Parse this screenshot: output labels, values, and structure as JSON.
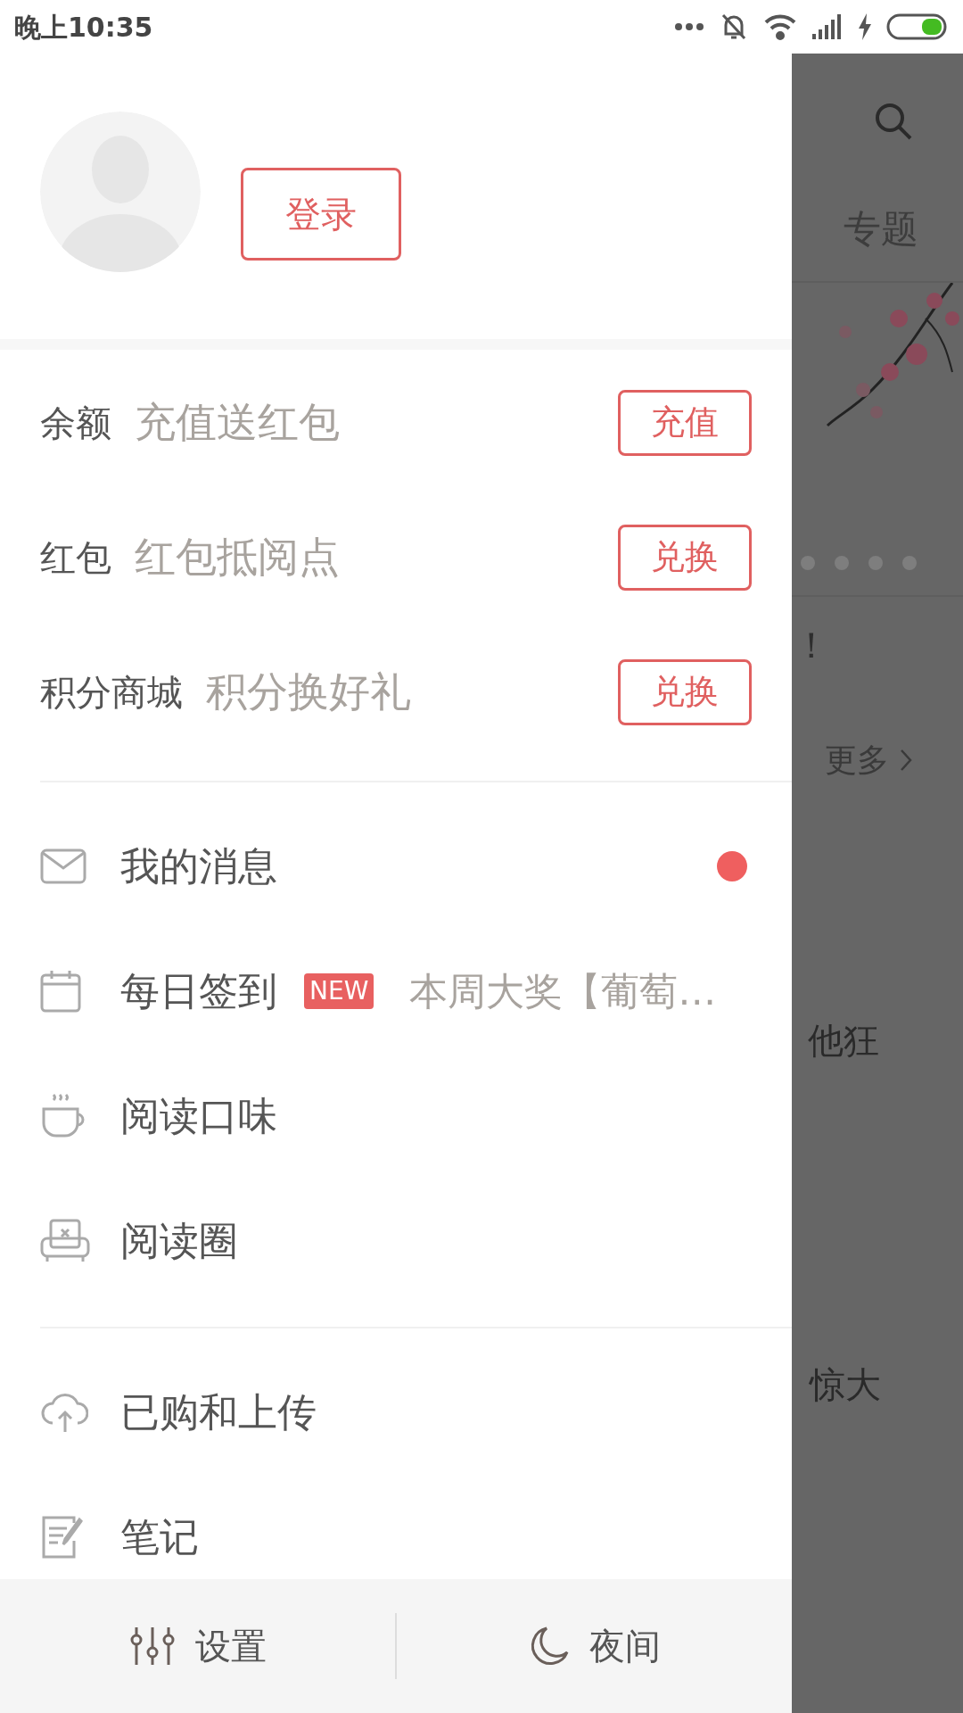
{
  "status_bar": {
    "time": "晚上10:35"
  },
  "profile": {
    "login_button": "登录"
  },
  "wallet_rows": [
    {
      "label": "余额",
      "hint": "充值送红包",
      "button": "充值"
    },
    {
      "label": "红包",
      "hint": "红包抵阅点",
      "button": "兑换"
    },
    {
      "label": "积分商城",
      "hint": "积分换好礼",
      "button": "兑换"
    }
  ],
  "menu_groups": [
    [
      {
        "label": "我的消息",
        "unread": true
      },
      {
        "label": "每日签到",
        "unread": false,
        "badge": "NEW",
        "note": "本周大奖【葡萄…"
      },
      {
        "label": "阅读口味",
        "unread": false
      },
      {
        "label": "阅读圈",
        "unread": false
      }
    ],
    [
      {
        "label": "已购和上传",
        "unread": false
      },
      {
        "label": "笔记",
        "unread": false
      }
    ]
  ],
  "bottom_bar": [
    {
      "label": "设置"
    },
    {
      "label": "夜间"
    }
  ],
  "background_page": {
    "tab": "专题",
    "headline_end": "！",
    "more_link": "更多",
    "snippets": [
      "他狂",
      "惊大"
    ]
  }
}
